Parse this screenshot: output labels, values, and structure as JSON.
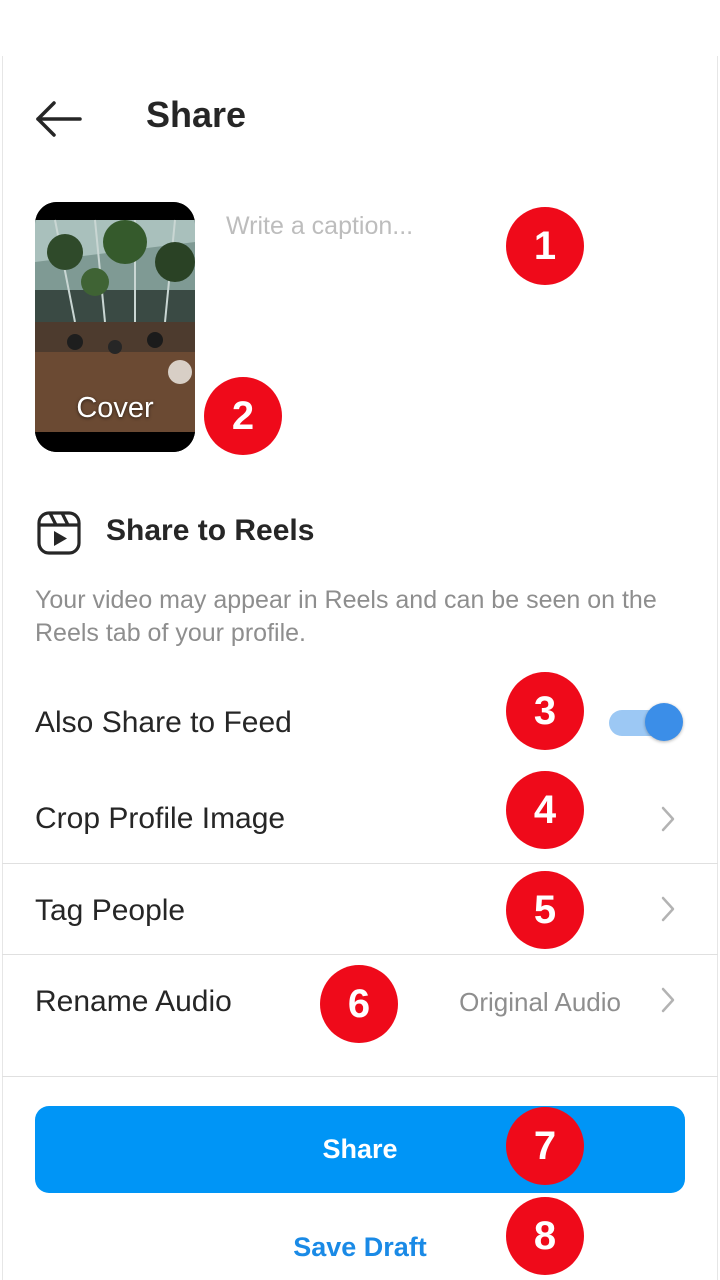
{
  "header": {
    "title": "Share",
    "back_icon": "arrow-left-icon"
  },
  "cover": {
    "label": "Cover"
  },
  "caption": {
    "placeholder": "Write a caption...",
    "value": ""
  },
  "reels": {
    "icon": "reels-icon",
    "title": "Share to Reels",
    "description": "Your video may appear in Reels and can be seen on the Reels tab of your profile."
  },
  "options": {
    "feed": {
      "label": "Also Share to Feed",
      "enabled": true
    },
    "crop": {
      "label": "Crop Profile Image"
    },
    "tag": {
      "label": "Tag People"
    },
    "audio": {
      "label": "Rename Audio",
      "value": "Original Audio"
    }
  },
  "actions": {
    "share_label": "Share",
    "draft_label": "Save Draft"
  },
  "badges": [
    "1",
    "2",
    "3",
    "4",
    "5",
    "6",
    "7",
    "8"
  ],
  "colors": {
    "accent": "#0095f6",
    "badge": "#ef0a1a",
    "toggle_on": "#3b8ee8"
  }
}
